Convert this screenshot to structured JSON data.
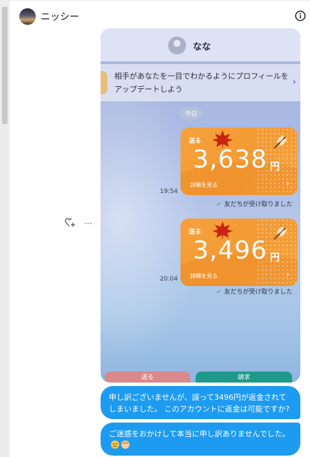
{
  "header": {
    "contact_name": "ニッシー",
    "info_icon": "info-icon"
  },
  "screenshot": {
    "contact_name": "なな",
    "banner_text": "相手があなたを一目でわかるようにプロフィールをアップデートしよう",
    "today_label": "今日",
    "transfers": [
      {
        "label": "送る",
        "amount": "3,638",
        "currency": "円",
        "details": "詳細を見る",
        "time": "19:54",
        "status": "友だちが受け取りました"
      },
      {
        "label": "送る",
        "amount": "3,496",
        "currency": "円",
        "details": "詳細を見る",
        "time": "20:04",
        "status": "友だちが受け取りました"
      }
    ],
    "bottom_buttons": {
      "send": "送る",
      "request": "請求"
    }
  },
  "actions": {
    "react_icon": "heart-plus-icon",
    "more_label": "…"
  },
  "messages": [
    {
      "text": "申し訳ございませんが、誤って3496円が返金されてしまいました。 このアカウントに返金は可能ですか?"
    },
    {
      "text": "ご迷惑をおかけして本当に申し訳ありませんでした。"
    }
  ],
  "colors": {
    "bubble": "#1d9bf0",
    "card": "#f6a13d",
    "check": "#16a06a"
  }
}
